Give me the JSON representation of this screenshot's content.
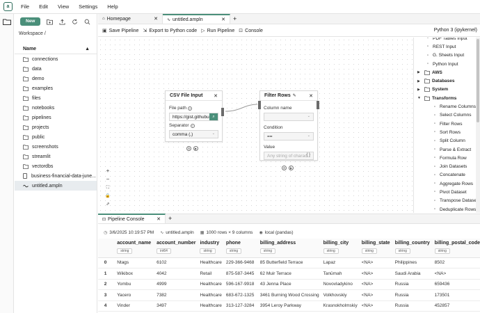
{
  "menubar": {
    "items": [
      "File",
      "Edit",
      "View",
      "Settings",
      "Help"
    ]
  },
  "sidebar": {
    "new_label": "New",
    "breadcrumb": "Workspace /",
    "header": "Name",
    "files": [
      {
        "name": "connections",
        "type": "folder"
      },
      {
        "name": "data",
        "type": "folder"
      },
      {
        "name": "demo",
        "type": "folder"
      },
      {
        "name": "examples",
        "type": "folder"
      },
      {
        "name": "files",
        "type": "folder"
      },
      {
        "name": "notebooks",
        "type": "folder"
      },
      {
        "name": "pipelines",
        "type": "folder"
      },
      {
        "name": "projects",
        "type": "folder"
      },
      {
        "name": "public",
        "type": "folder"
      },
      {
        "name": "screenshots",
        "type": "folder"
      },
      {
        "name": "streamlit",
        "type": "folder"
      },
      {
        "name": "vectordbs",
        "type": "folder"
      },
      {
        "name": "business-financial-data-june...",
        "type": "file"
      },
      {
        "name": "untitled.ampln",
        "type": "pipeline"
      }
    ]
  },
  "tabs": {
    "home": "Homepage",
    "active": "untitled.ampln",
    "add": "+"
  },
  "toolbar": {
    "save": "Save Pipeline",
    "export": "Export to Python code",
    "run": "Run Pipeline",
    "console": "Console",
    "kernel": "Python 3 (ipykernel)"
  },
  "csv_node": {
    "title": "CSV File Input",
    "file_path_label": "File path",
    "file_path_value": "https://gist.githubu",
    "separator_label": "Separator",
    "separator_value": "comma (,)"
  },
  "filter_node": {
    "title": "Filter Rows",
    "column_label": "Column name",
    "condition_label": "Condition",
    "condition_value": "==",
    "value_label": "Value",
    "value_placeholder": "Any string of charac..."
  },
  "palette": {
    "items": [
      {
        "label": "PDF Tables Input",
        "kind": "sub"
      },
      {
        "label": "REST Input",
        "kind": "sub"
      },
      {
        "label": "G. Sheets Input",
        "kind": "sub"
      },
      {
        "label": "Python Input",
        "kind": "sub"
      },
      {
        "label": "AWS",
        "kind": "cat"
      },
      {
        "label": "Databases",
        "kind": "cat"
      },
      {
        "label": "System",
        "kind": "cat"
      },
      {
        "label": "Transforms",
        "kind": "cat-open"
      },
      {
        "label": "Rename Columns",
        "kind": "t"
      },
      {
        "label": "Select Columns",
        "kind": "t"
      },
      {
        "label": "Filter Rows",
        "kind": "t"
      },
      {
        "label": "Sort Rows",
        "kind": "t"
      },
      {
        "label": "Split Column",
        "kind": "t"
      },
      {
        "label": "Parse & Extract",
        "kind": "t"
      },
      {
        "label": "Formula Row",
        "kind": "t"
      },
      {
        "label": "Join Datasets",
        "kind": "t"
      },
      {
        "label": "Concatenate",
        "kind": "t"
      },
      {
        "label": "Aggregate Rows",
        "kind": "t"
      },
      {
        "label": "Pivot Dataset",
        "kind": "t"
      },
      {
        "label": "Transpose Dataset",
        "kind": "t"
      },
      {
        "label": "Deduplicate Rows",
        "kind": "t"
      }
    ]
  },
  "console": {
    "tab": "Pipeline Console",
    "timestamp": "3/6/2025 10:19:57 PM",
    "file": "untitled.ampln",
    "shape": "1000 rows × 9 columns",
    "engine": "local (pandas)",
    "columns": [
      {
        "name": "account_name",
        "dtype": "string"
      },
      {
        "name": "account_number",
        "dtype": "int64"
      },
      {
        "name": "industry",
        "dtype": "string"
      },
      {
        "name": "phone",
        "dtype": "string"
      },
      {
        "name": "billing_address",
        "dtype": "string"
      },
      {
        "name": "billing_city",
        "dtype": "string"
      },
      {
        "name": "billing_state",
        "dtype": "string"
      },
      {
        "name": "billing_country",
        "dtype": "string"
      },
      {
        "name": "billing_postal_code",
        "dtype": "string"
      }
    ],
    "rows": [
      [
        "0",
        "Ntags",
        "6102",
        "Healthcare",
        "229-366-9468",
        "85 Butterfield Terrace",
        "Lapaz",
        "<NA>",
        "Philippines",
        "8502"
      ],
      [
        "1",
        "Wikibox",
        "4042",
        "Retail",
        "875-587-3445",
        "62 Muir Terrace",
        "Tanūmah",
        "<NA>",
        "Saudi Arabia",
        "<NA>"
      ],
      [
        "2",
        "Yombu",
        "4999",
        "Healthcare",
        "596-167-9918",
        "43 Jenna Place",
        "Novovladykino",
        "<NA>",
        "Russia",
        "659436"
      ],
      [
        "3",
        "Yacero",
        "7382",
        "Healthcare",
        "683-672-1325",
        "3461 Burning Wood Crossing",
        "Volkhovskiy",
        "<NA>",
        "Russia",
        "173501"
      ],
      [
        "4",
        "Vinder",
        "3497",
        "Healthcare",
        "313-127-3284",
        "3954 Leroy Parkway",
        "Krasnokholmskiy",
        "<NA>",
        "Russia",
        "452857"
      ]
    ]
  },
  "colors": {
    "accent": "#4a8f7a"
  }
}
